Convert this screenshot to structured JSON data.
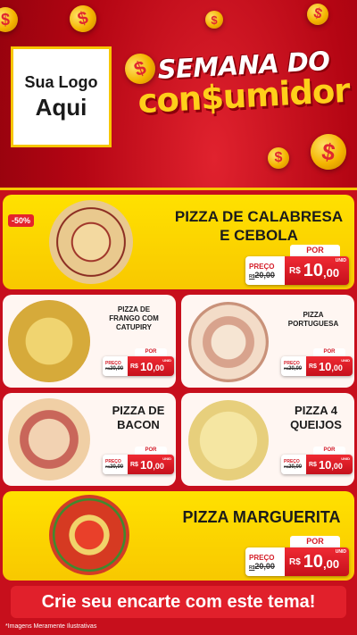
{
  "brand": {
    "logo_line1": "Sua Logo",
    "logo_line2": "Aqui",
    "headline_top": "SEMANA DO",
    "headline_bottom": "con$umidor",
    "coin_symbol": "$"
  },
  "colors": {
    "background": "#b40513",
    "accent_yellow": "#f8c800",
    "price_red": "#d41c27"
  },
  "featured": [
    {
      "name_line1": "PIZZA DE CALABRESA",
      "name_line2": "E CEBOLA",
      "badge": "-50%",
      "por": "POR",
      "preco": "PREÇO",
      "old_prefix": "R$",
      "old_price": "20,00",
      "currency": "R$",
      "price_int": "10",
      "price_dec": ",00",
      "unit": "UNID"
    },
    {
      "name_line1": "PIZZA MARGUERITA",
      "por": "POR",
      "preco": "PREÇO",
      "old_prefix": "R$",
      "old_price": "20,00",
      "currency": "R$",
      "price_int": "10",
      "price_dec": ",00",
      "unit": "UNID"
    }
  ],
  "items": [
    {
      "name_line1": "PIZZA DE",
      "name_line2": "FRANGO COM",
      "name_line3": "CATUPIRY",
      "por": "POR",
      "preco": "PREÇO",
      "old_prefix": "R$",
      "old_price": "20,00",
      "currency": "R$",
      "price_int": "10",
      "price_dec": ",00",
      "unit": "UNID"
    },
    {
      "name_line1": "PIZZA",
      "name_line2": "PORTUGUESA",
      "por": "POR",
      "preco": "PREÇO",
      "old_prefix": "R$",
      "old_price": "20,00",
      "currency": "R$",
      "price_int": "10",
      "price_dec": ",00",
      "unit": "UNID"
    },
    {
      "name_line1": "PIZZA DE",
      "name_line2": "BACON",
      "por": "POR",
      "preco": "PREÇO",
      "old_prefix": "R$",
      "old_price": "20,00",
      "currency": "R$",
      "price_int": "10",
      "price_dec": ",00",
      "unit": "UNID"
    },
    {
      "name_line1": "PIZZA 4",
      "name_line2": "QUEIJOS",
      "por": "POR",
      "preco": "PREÇO",
      "old_prefix": "R$",
      "old_price": "20,00",
      "currency": "R$",
      "price_int": "10",
      "price_dec": ",00",
      "unit": "UNID"
    }
  ],
  "footer": {
    "banner": "Crie seu encarte com este tema!",
    "disclaimer": "*Imagens Meramente Ilustrativas"
  }
}
